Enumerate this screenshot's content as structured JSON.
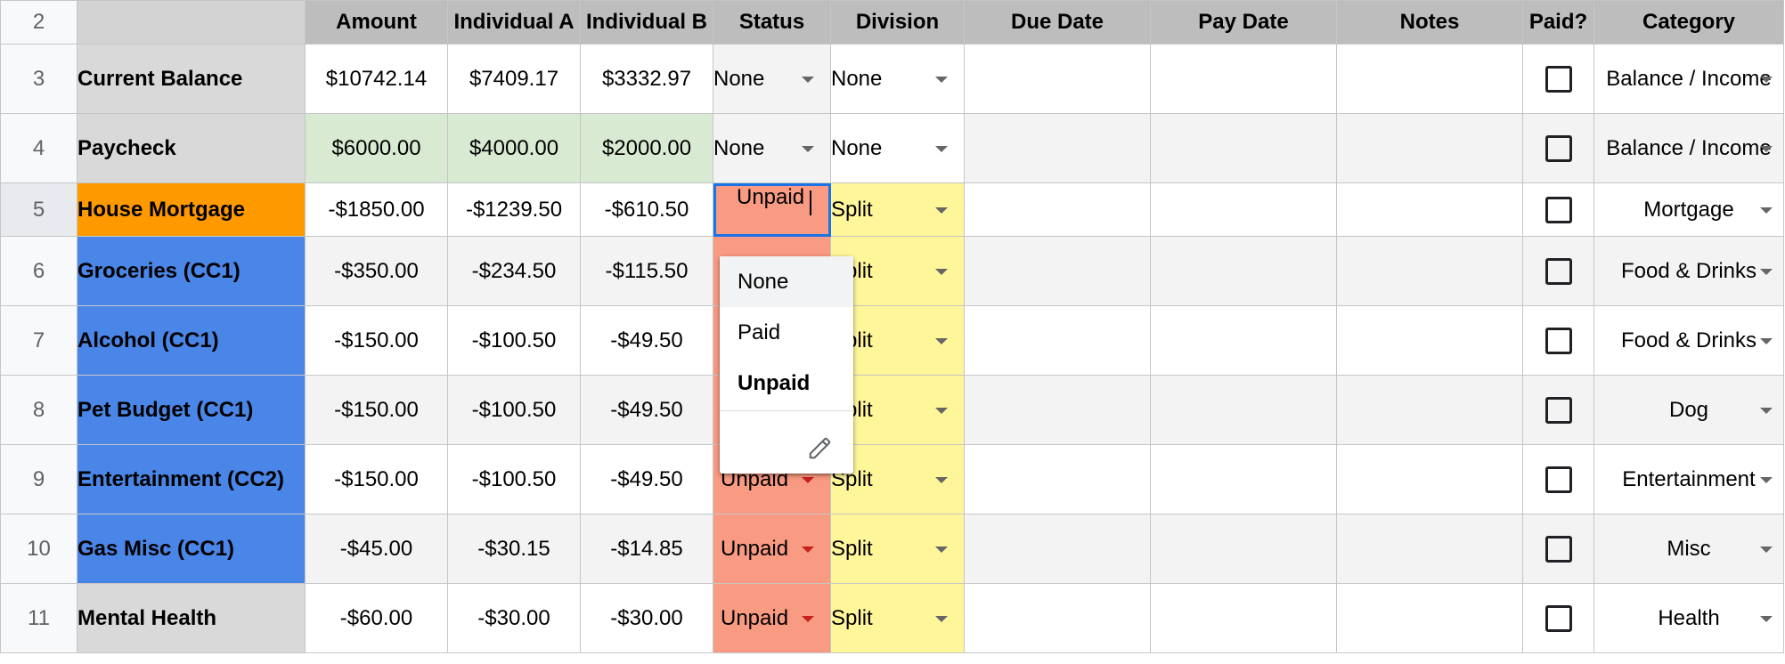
{
  "header": {
    "row_number": "2",
    "columns": [
      "",
      "Amount",
      "Individual A",
      "Individual B",
      "Status",
      "Division",
      "Due Date",
      "Pay Date",
      "Notes",
      "Paid?",
      "Category"
    ]
  },
  "rows": [
    {
      "num": "3",
      "name": "Current Balance",
      "amount": "$10742.14",
      "a": "$7409.17",
      "b": "$3332.97",
      "status": "None",
      "division": "None",
      "category": "Balance / Income"
    },
    {
      "num": "4",
      "name": "Paycheck",
      "amount": "$6000.00",
      "a": "$4000.00",
      "b": "$2000.00",
      "status": "None",
      "division": "None",
      "category": "Balance / Income"
    },
    {
      "num": "5",
      "name": "House Mortgage",
      "amount": "-$1850.00",
      "a": "-$1239.50",
      "b": "-$610.50",
      "status": "Unpaid",
      "division": "Split",
      "category": "Mortgage"
    },
    {
      "num": "6",
      "name": "Groceries (CC1)",
      "amount": "-$350.00",
      "a": "-$234.50",
      "b": "-$115.50",
      "status": "",
      "division": "Split",
      "category": "Food & Drinks"
    },
    {
      "num": "7",
      "name": "Alcohol (CC1)",
      "amount": "-$150.00",
      "a": "-$100.50",
      "b": "-$49.50",
      "status": "",
      "division": "Split",
      "category": "Food & Drinks"
    },
    {
      "num": "8",
      "name": "Pet Budget (CC1)",
      "amount": "-$150.00",
      "a": "-$100.50",
      "b": "-$49.50",
      "status": "",
      "division": "Split",
      "category": "Dog"
    },
    {
      "num": "9",
      "name": "Entertainment (CC2)",
      "amount": "-$150.00",
      "a": "-$100.50",
      "b": "-$49.50",
      "status": "Unpaid",
      "division": "Split",
      "category": "Entertainment"
    },
    {
      "num": "10",
      "name": "Gas Misc (CC1)",
      "amount": "-$45.00",
      "a": "-$30.15",
      "b": "-$14.85",
      "status": "Unpaid",
      "division": "Split",
      "category": "Misc"
    },
    {
      "num": "11",
      "name": "Mental Health",
      "amount": "-$60.00",
      "a": "-$30.00",
      "b": "-$30.00",
      "status": "Unpaid",
      "division": "Split",
      "category": "Health"
    }
  ],
  "dropdown": {
    "options": [
      "None",
      "Paid",
      "Unpaid"
    ],
    "selected": "Unpaid",
    "edit_icon": "pencil-icon"
  },
  "colors": {
    "header_bg": "#bdbdbd",
    "orange": "#ff9900",
    "blue": "#4a86e8",
    "green": "#d9ead3",
    "unpaid": "#f99a82",
    "split": "#fff599",
    "selection": "#1a73e8"
  }
}
